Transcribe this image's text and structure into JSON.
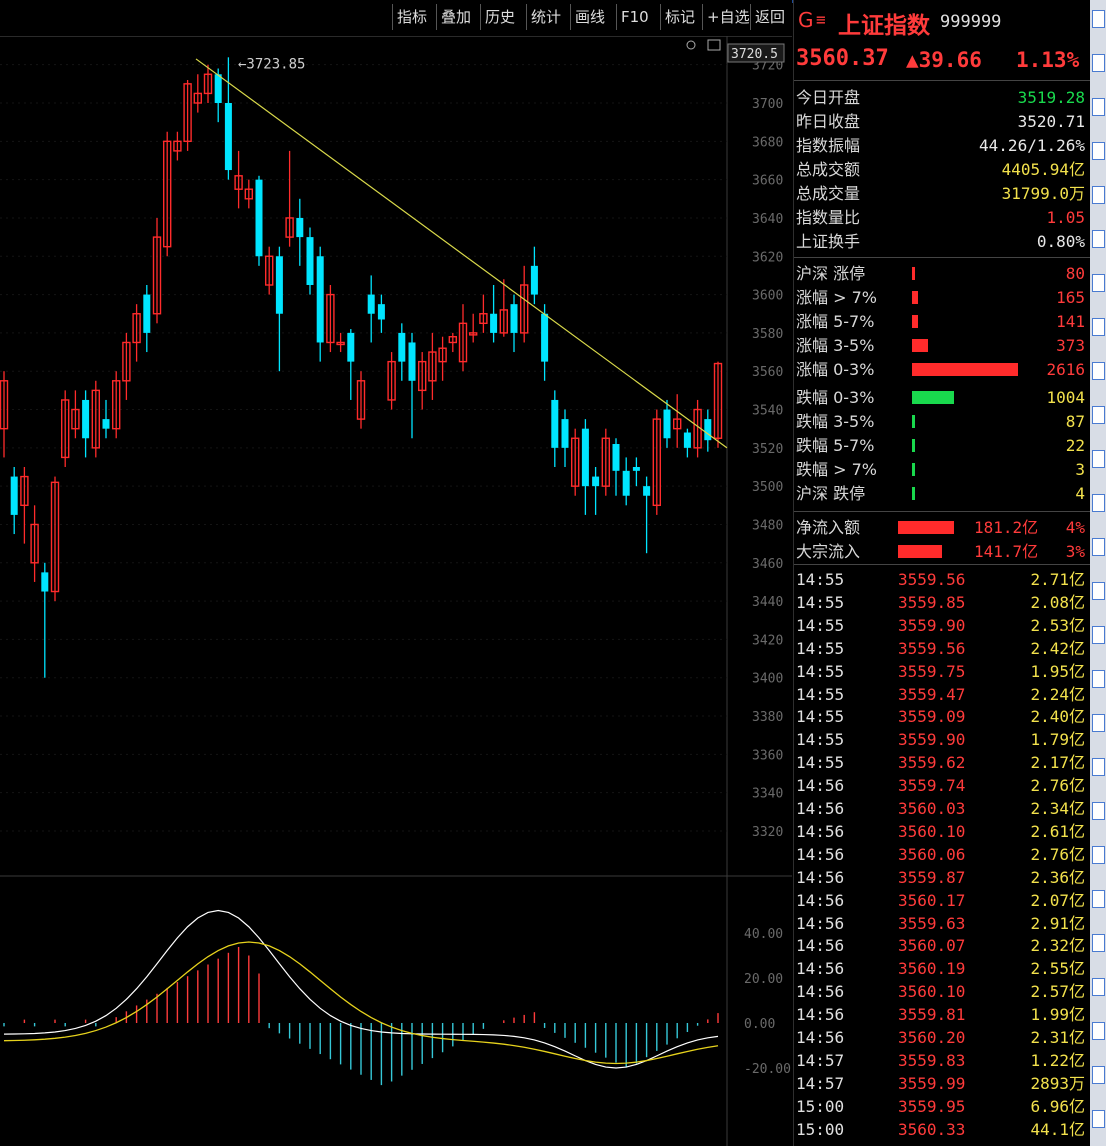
{
  "toolbar": {
    "buttons": [
      "指标",
      "叠加",
      "历史",
      "统计",
      "画线",
      "F10",
      "标记",
      "+自选",
      "返回"
    ]
  },
  "chart": {
    "high_label": "3723.85",
    "price_box": "3720.5",
    "candles": [
      [
        3530,
        3555,
        3515,
        3560
      ],
      [
        3505,
        3485,
        3475,
        3510
      ],
      [
        3490,
        3505,
        3470,
        3510
      ],
      [
        3460,
        3480,
        3450,
        3490
      ],
      [
        3455,
        3445,
        3400,
        3460
      ],
      [
        3445,
        3502,
        3440,
        3505
      ],
      [
        3515,
        3545,
        3510,
        3550
      ],
      [
        3530,
        3540,
        3525,
        3550
      ],
      [
        3545,
        3525,
        3515,
        3550
      ],
      [
        3520,
        3550,
        3515,
        3555
      ],
      [
        3535,
        3530,
        3525,
        3545
      ],
      [
        3530,
        3555,
        3525,
        3560
      ],
      [
        3555,
        3575,
        3545,
        3580
      ],
      [
        3575,
        3590,
        3565,
        3595
      ],
      [
        3600,
        3580,
        3570,
        3605
      ],
      [
        3590,
        3630,
        3585,
        3640
      ],
      [
        3625,
        3680,
        3620,
        3685
      ],
      [
        3675,
        3680,
        3670,
        3685
      ],
      [
        3680,
        3710,
        3675,
        3712
      ],
      [
        3700,
        3705,
        3695,
        3715
      ],
      [
        3705,
        3715,
        3700,
        3720
      ],
      [
        3715,
        3700,
        3690,
        3718
      ],
      [
        3700,
        3665,
        3660,
        3723.85
      ],
      [
        3655,
        3662,
        3645,
        3675
      ],
      [
        3650,
        3655,
        3645,
        3660
      ],
      [
        3660,
        3620,
        3615,
        3662
      ],
      [
        3605,
        3620,
        3600,
        3625
      ],
      [
        3620,
        3590,
        3560,
        3625
      ],
      [
        3630,
        3640,
        3625,
        3675
      ],
      [
        3640,
        3630,
        3615,
        3650
      ],
      [
        3630,
        3605,
        3600,
        3635
      ],
      [
        3620,
        3575,
        3565,
        3625
      ],
      [
        3575,
        3600,
        3570,
        3605
      ],
      [
        3575,
        3575,
        3570,
        3580
      ],
      [
        3580,
        3565,
        3545,
        3582
      ],
      [
        3535,
        3555,
        3530,
        3560
      ],
      [
        3600,
        3590,
        3575,
        3610
      ],
      [
        3595,
        3587,
        3580,
        3600
      ],
      [
        3545,
        3565,
        3540,
        3570
      ],
      [
        3580,
        3565,
        3555,
        3585
      ],
      [
        3575,
        3555,
        3525,
        3580
      ],
      [
        3550,
        3565,
        3540,
        3570
      ],
      [
        3555,
        3570,
        3545,
        3580
      ],
      [
        3565,
        3572,
        3555,
        3578
      ],
      [
        3575,
        3578,
        3570,
        3580
      ],
      [
        3565,
        3585,
        3560,
        3595
      ],
      [
        3580,
        3580,
        3575,
        3590
      ],
      [
        3585,
        3590,
        3580,
        3600
      ],
      [
        3590,
        3580,
        3575,
        3605
      ],
      [
        3580,
        3592,
        3578,
        3608
      ],
      [
        3595,
        3580,
        3570,
        3600
      ],
      [
        3580,
        3605,
        3575,
        3615
      ],
      [
        3615,
        3600,
        3595,
        3625
      ],
      [
        3590,
        3565,
        3555,
        3595
      ],
      [
        3545,
        3520,
        3510,
        3550
      ],
      [
        3535,
        3520,
        3510,
        3540
      ],
      [
        3500,
        3525,
        3495,
        3530
      ],
      [
        3530,
        3500,
        3485,
        3535
      ],
      [
        3505,
        3500,
        3485,
        3510
      ],
      [
        3500,
        3525,
        3495,
        3530
      ],
      [
        3522,
        3508,
        3495,
        3525
      ],
      [
        3508,
        3495,
        3490,
        3515
      ],
      [
        3510,
        3508,
        3500,
        3515
      ],
      [
        3500,
        3495,
        3465,
        3505
      ],
      [
        3490,
        3535,
        3485,
        3540
      ],
      [
        3540,
        3525,
        3520,
        3545
      ],
      [
        3530,
        3535,
        3520,
        3548
      ],
      [
        3528,
        3520,
        3515,
        3530
      ],
      [
        3520,
        3540,
        3515,
        3545
      ],
      [
        3535,
        3524,
        3518,
        3540
      ],
      [
        3525,
        3564,
        3520,
        3565
      ]
    ]
  },
  "panel": {
    "logo": "G",
    "name": "上证指数",
    "code": "999999",
    "price": "3560.37",
    "change": "▲39.66",
    "pct": "1.13%",
    "stats": [
      {
        "label": "今日开盘",
        "value": "3519.28",
        "cls": "grn"
      },
      {
        "label": "昨日收盘",
        "value": "3520.71",
        "cls": "wht"
      },
      {
        "label": "指数振幅",
        "value": "44.26/1.26%",
        "cls": "wht"
      },
      {
        "label": "总成交额",
        "value": "4405.94亿",
        "cls": "yel"
      },
      {
        "label": "总成交量",
        "value": "31799.0万",
        "cls": "yel"
      },
      {
        "label": "指数量比",
        "value": "1.05",
        "cls": "red"
      },
      {
        "label": "上证换手",
        "value": "0.80%",
        "cls": "wht"
      }
    ],
    "breadth": [
      {
        "label": "沪深 涨停",
        "value": "80",
        "color": "#ff2b2b",
        "frac": 0.01
      },
      {
        "label": "涨幅 > 7%",
        "value": "165",
        "color": "#ff2b2b",
        "frac": 0.02
      },
      {
        "label": "涨幅 5-7%",
        "value": "141",
        "color": "#ff2b2b",
        "frac": 0.02
      },
      {
        "label": "涨幅 3-5%",
        "value": "373",
        "color": "#ff2b2b",
        "frac": 0.05
      },
      {
        "label": "涨幅 0-3%",
        "value": "2616",
        "color": "#ff2b2b",
        "frac": 0.33
      },
      {
        "label": "跌幅 0-3%",
        "value": "1004",
        "color": "#19d94d",
        "frac": 0.13
      },
      {
        "label": "跌幅 3-5%",
        "value": "87",
        "color": "#19d94d",
        "frac": 0.01
      },
      {
        "label": "跌幅 5-7%",
        "value": "22",
        "color": "#19d94d",
        "frac": 0.005
      },
      {
        "label": "跌幅 > 7%",
        "value": "3",
        "color": "#19d94d",
        "frac": 0.003
      },
      {
        "label": "沪深 跌停",
        "value": "4",
        "color": "#19d94d",
        "frac": 0.003
      }
    ],
    "flows": [
      {
        "label": "净流入额",
        "amount": "181.2亿",
        "pct": "4%"
      },
      {
        "label": "大宗流入",
        "amount": "141.7亿",
        "pct": "3%"
      }
    ],
    "ticks": [
      [
        "14:55",
        "3559.56",
        "2.71亿"
      ],
      [
        "14:55",
        "3559.85",
        "2.08亿"
      ],
      [
        "14:55",
        "3559.90",
        "2.53亿"
      ],
      [
        "14:55",
        "3559.56",
        "2.42亿"
      ],
      [
        "14:55",
        "3559.75",
        "1.95亿"
      ],
      [
        "14:55",
        "3559.47",
        "2.24亿"
      ],
      [
        "14:55",
        "3559.09",
        "2.40亿"
      ],
      [
        "14:55",
        "3559.90",
        "1.79亿"
      ],
      [
        "14:55",
        "3559.62",
        "2.17亿"
      ],
      [
        "14:56",
        "3559.74",
        "2.76亿"
      ],
      [
        "14:56",
        "3560.03",
        "2.34亿"
      ],
      [
        "14:56",
        "3560.10",
        "2.61亿"
      ],
      [
        "14:56",
        "3560.06",
        "2.76亿"
      ],
      [
        "14:56",
        "3559.87",
        "2.36亿"
      ],
      [
        "14:56",
        "3560.17",
        "2.07亿"
      ],
      [
        "14:56",
        "3559.63",
        "2.91亿"
      ],
      [
        "14:56",
        "3560.07",
        "2.32亿"
      ],
      [
        "14:56",
        "3560.19",
        "2.55亿"
      ],
      [
        "14:56",
        "3560.10",
        "2.57亿"
      ],
      [
        "14:56",
        "3559.81",
        "1.99亿"
      ],
      [
        "14:56",
        "3560.20",
        "2.31亿"
      ],
      [
        "14:57",
        "3559.83",
        "1.22亿"
      ],
      [
        "14:57",
        "3559.99",
        "2893万"
      ],
      [
        "15:00",
        "3559.95",
        "6.96亿"
      ],
      [
        "15:00",
        "3560.33",
        "44.1亿"
      ]
    ]
  },
  "colors": {
    "up": "#ff2b2b",
    "down": "#00e5ff",
    "trend": "#d9d94a"
  }
}
